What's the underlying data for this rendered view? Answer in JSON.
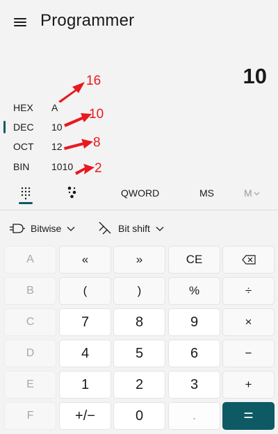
{
  "header": {
    "title": "Programmer",
    "menu_icon": "hamburger-icon"
  },
  "display": {
    "value": "10"
  },
  "radix": [
    {
      "label": "HEX",
      "value": "A",
      "selected": false
    },
    {
      "label": "DEC",
      "value": "10",
      "selected": true
    },
    {
      "label": "OCT",
      "value": "12",
      "selected": false
    },
    {
      "label": "BIN",
      "value": "1010",
      "selected": false
    }
  ],
  "annotations": {
    "color": "#e8191f",
    "labels": [
      "16",
      "10",
      "8",
      "2"
    ]
  },
  "mode_bar": {
    "keypad_icon": "full-keypad-icon",
    "bit_icon": "bit-toggling-keypad-icon",
    "word_size": "QWORD",
    "memory_store": "MS",
    "memory_menu": "M"
  },
  "operators": {
    "bitwise": "Bitwise",
    "bitshift": "Bit shift"
  },
  "keypad": {
    "accent": "#0e5a64",
    "rows": [
      [
        "A",
        "«",
        "»",
        "CE",
        "backspace"
      ],
      [
        "B",
        "(",
        ")",
        "%",
        "÷"
      ],
      [
        "C",
        "7",
        "8",
        "9",
        "×"
      ],
      [
        "D",
        "4",
        "5",
        "6",
        "−"
      ],
      [
        "E",
        "1",
        "2",
        "3",
        "+"
      ],
      [
        "F",
        "+/−",
        "0",
        ".",
        "="
      ]
    ],
    "labels": {
      "a": "A",
      "b": "B",
      "c": "C",
      "d": "D",
      "e": "E",
      "f": "F",
      "lshift": "«",
      "rshift": "»",
      "ce": "CE",
      "lparen": "(",
      "rparen": ")",
      "percent": "%",
      "n7": "7",
      "n8": "8",
      "n9": "9",
      "n4": "4",
      "n5": "5",
      "n6": "6",
      "n1": "1",
      "n2": "2",
      "n3": "3",
      "n0": "0",
      "dot": ".",
      "negate": "+/−",
      "divide": "÷",
      "multiply": "×",
      "minus": "−",
      "plus": "+",
      "equals": "="
    }
  }
}
